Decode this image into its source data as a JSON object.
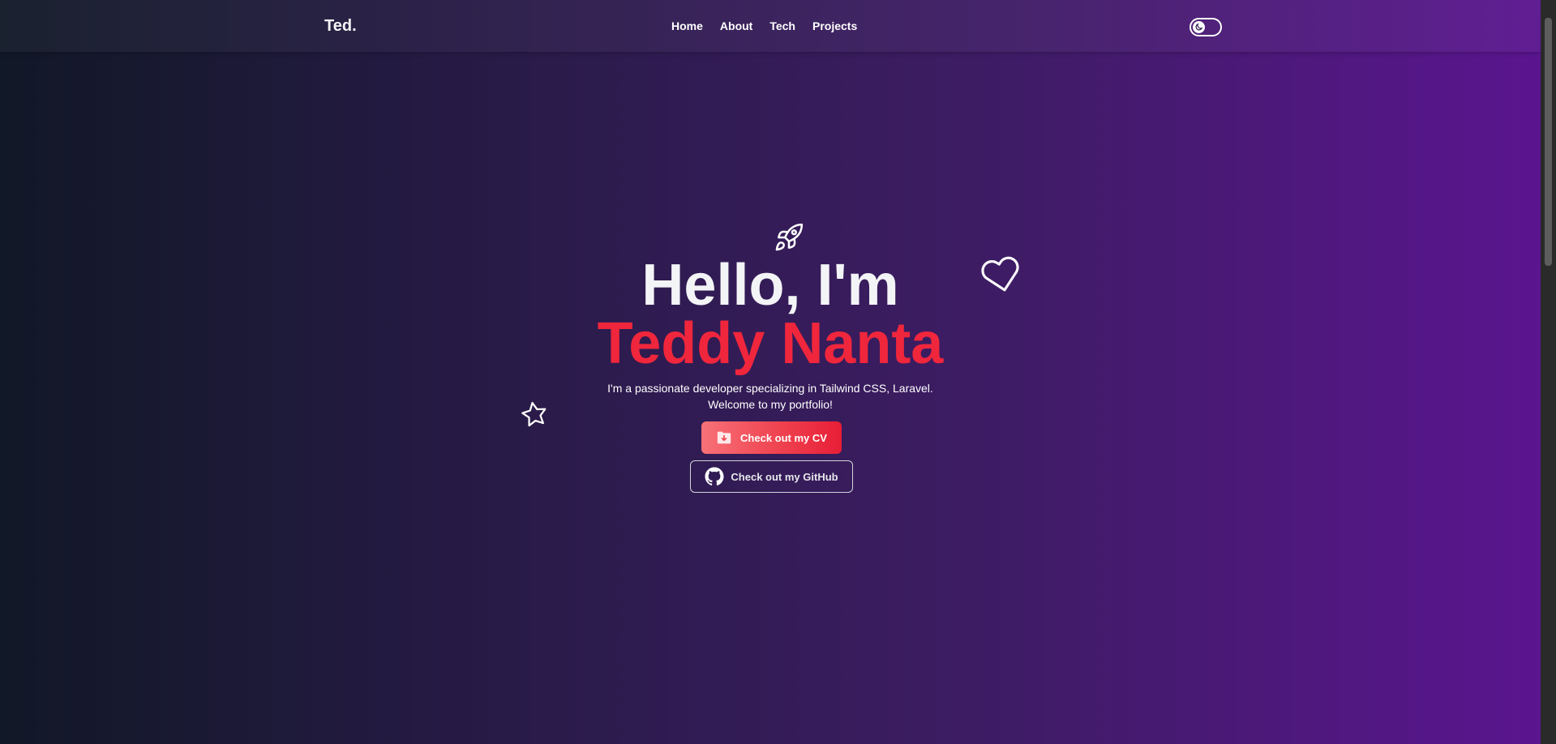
{
  "navbar": {
    "brand": "Ted.",
    "links": [
      "Home",
      "About",
      "Tech",
      "Projects"
    ],
    "theme_toggle_icon": "moon-icon"
  },
  "hero": {
    "greeting": "Hello, I'm",
    "name": "Teddy Nanta",
    "description_line1": "I'm a passionate developer specializing in Tailwind CSS, Laravel.",
    "description_line2": "Welcome to my portfolio!",
    "cv_button_label": "Check out my CV",
    "github_button_label": "Check out my GitHub",
    "decorations": [
      "rocket-icon",
      "heart-icon",
      "star-icon"
    ]
  },
  "colors": {
    "accent": "#f0263c",
    "gradient_start": "#111827",
    "gradient_end": "#5b1590"
  }
}
